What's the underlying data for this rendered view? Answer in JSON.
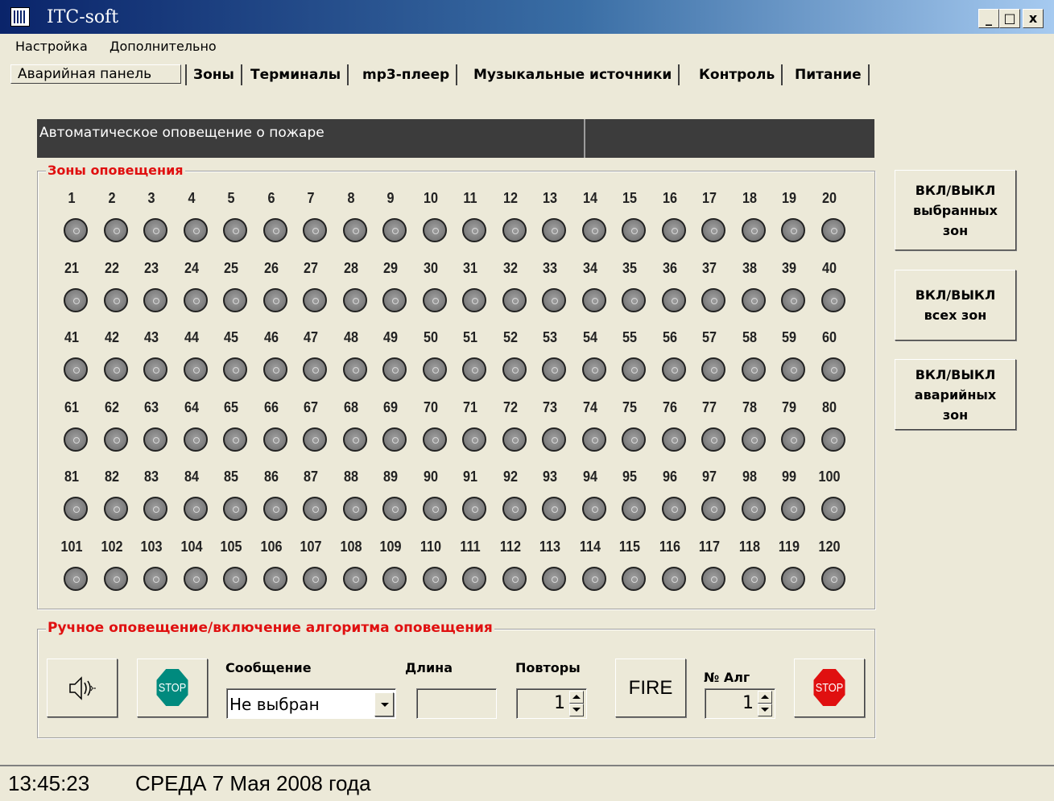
{
  "window": {
    "title": "ITC-soft",
    "minimize_label": "_",
    "maximize_label": "□",
    "close_label": "x"
  },
  "menu": [
    "Настройка",
    "Дополнительно"
  ],
  "tabs": [
    "Аварийная панель",
    "Зоны",
    "Терминалы",
    "mp3-плеер",
    "Музыкальные источники",
    "Контроль",
    "Питание"
  ],
  "header": {
    "text": "Автоматическое оповещение о пожаре",
    "secondary": ""
  },
  "zones": {
    "title": "Зоны оповещения",
    "count": 120,
    "state": "off"
  },
  "side_buttons": [
    "ВКЛ/ВЫКЛ\nвыбранных\nзон",
    "ВКЛ/ВЫКЛ\nвсех зон",
    "ВКЛ/ВЫКЛ\nаварийных\nзон"
  ],
  "manual": {
    "title": "Ручное оповещение/включение алгоритма оповещения",
    "speaker_icon": "speaker-icon",
    "stop_label": "STOP",
    "message_label": "Сообщение",
    "message_value": "Не выбран",
    "length_label": "Длина",
    "length_value": "",
    "repeats_label": "Повторы",
    "repeats_value": "1",
    "fire_label": "FIRE",
    "alg_label": "№ Алг",
    "alg_value": "1",
    "stop2_label": "STOP"
  },
  "colors": {
    "stop_green": "#008a7e",
    "stop_red": "#e01010",
    "legend_red": "#e01010",
    "header_bg": "#3c3c3c"
  },
  "status": {
    "time": "13:45:23",
    "date": "СРЕДА 7 Мая 2008 года"
  }
}
